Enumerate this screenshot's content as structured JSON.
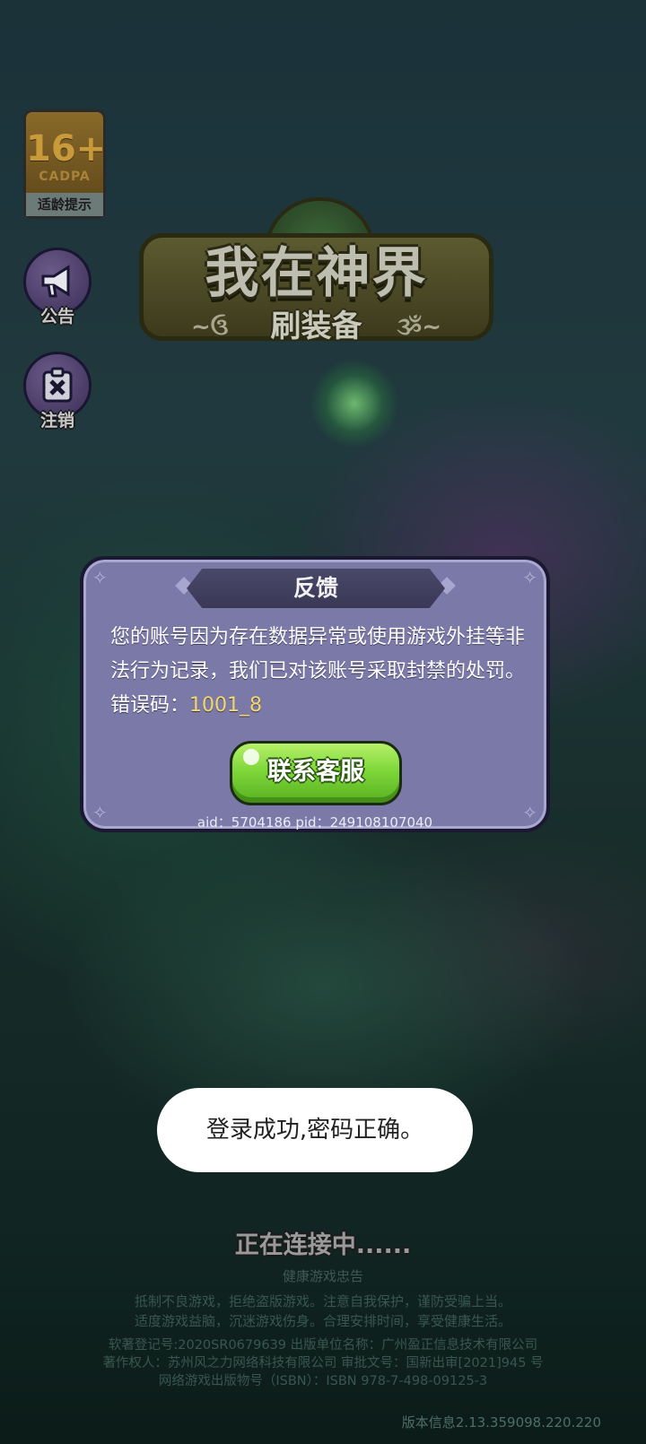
{
  "age_badge": {
    "rating": "16+",
    "org": "CADPA",
    "tip": "适龄提示"
  },
  "side_buttons": [
    {
      "label": "公告",
      "icon": "megaphone-icon"
    },
    {
      "label": "注销",
      "icon": "close-badge-icon"
    }
  ],
  "logo": {
    "title": "我在神界",
    "subtitle": "刷装备"
  },
  "dialog": {
    "title": "反馈",
    "message": "您的账号因为存在数据异常或使用游戏外挂等非法行为记录，我们已对该账号采取封禁的处罚。错误码：",
    "error_code": "1001_8",
    "button_label": "联系客服",
    "ids": "aid：5704186 pid：249108107040"
  },
  "toast": {
    "text": "登录成功,密码正确。"
  },
  "status": {
    "connecting": "正在连接中......"
  },
  "health_notice": {
    "title": "健康游戏忠告",
    "lines": [
      "抵制不良游戏，拒绝盗版游戏。注意自我保护，谨防受骗上当。",
      "适度游戏益脑，沉迷游戏伤身。合理安排时间，享受健康生活。"
    ]
  },
  "legal": {
    "lines": [
      "软著登记号:2020SR0679639 出版单位名称：广州盈正信息技术有限公司",
      "著作权人：苏州风之力网络科技有限公司 审批文号：国新出审[2021]945 号",
      "网络游戏出版物号（ISBN）：ISBN 978-7-498-09125-3"
    ]
  },
  "version": "版本信息2.13.359098.220.220",
  "colors": {
    "dialog_bg": "#7b79a8",
    "button_green": "#7fd83a",
    "error_code": "#f3d86a"
  }
}
